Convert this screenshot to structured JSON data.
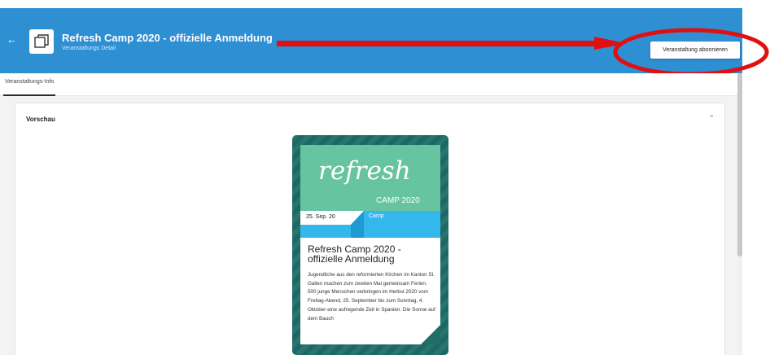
{
  "header": {
    "title": "Refresh Camp 2020 - offizielle Anmeldung",
    "subtitle": "Veranstaltungs Detail",
    "subscribe_label": "Veranstaltung abonnieren",
    "back_icon": "arrow-left-icon",
    "event_icon": "event-calendar-icon"
  },
  "tabs": [
    {
      "label": "Veranstaltungs-Info"
    }
  ],
  "preview_section": {
    "title": "Vorschau",
    "collapse_icon": "chevron-up-icon"
  },
  "preview_card": {
    "logo_text": "refresh",
    "logo_subtitle": "CAMP 2020",
    "date": "25. Sep. 20",
    "type": "Camp",
    "title": "Refresh Camp 2020 - offizielle Anmeldung",
    "description": "Jugendliche aus den reformierten Kirchen im Kanton St. Gallen machen zum zweiten Mal gemeinsam Ferien. 500 junge Menschen verbringen im Herbst 2020 vom  Freitag-Abend,  25. September bis zum Sonntag, 4. Oktober  eine aufregende Zeit in Spanien. Die Sonne auf dem Bauch"
  },
  "colors": {
    "header_bg": "#2e8fd3",
    "annotation_red": "#e01010",
    "card_teal": "#1f6e6a",
    "logo_green": "#66c4a1",
    "band_blue": "#34b7ed"
  }
}
